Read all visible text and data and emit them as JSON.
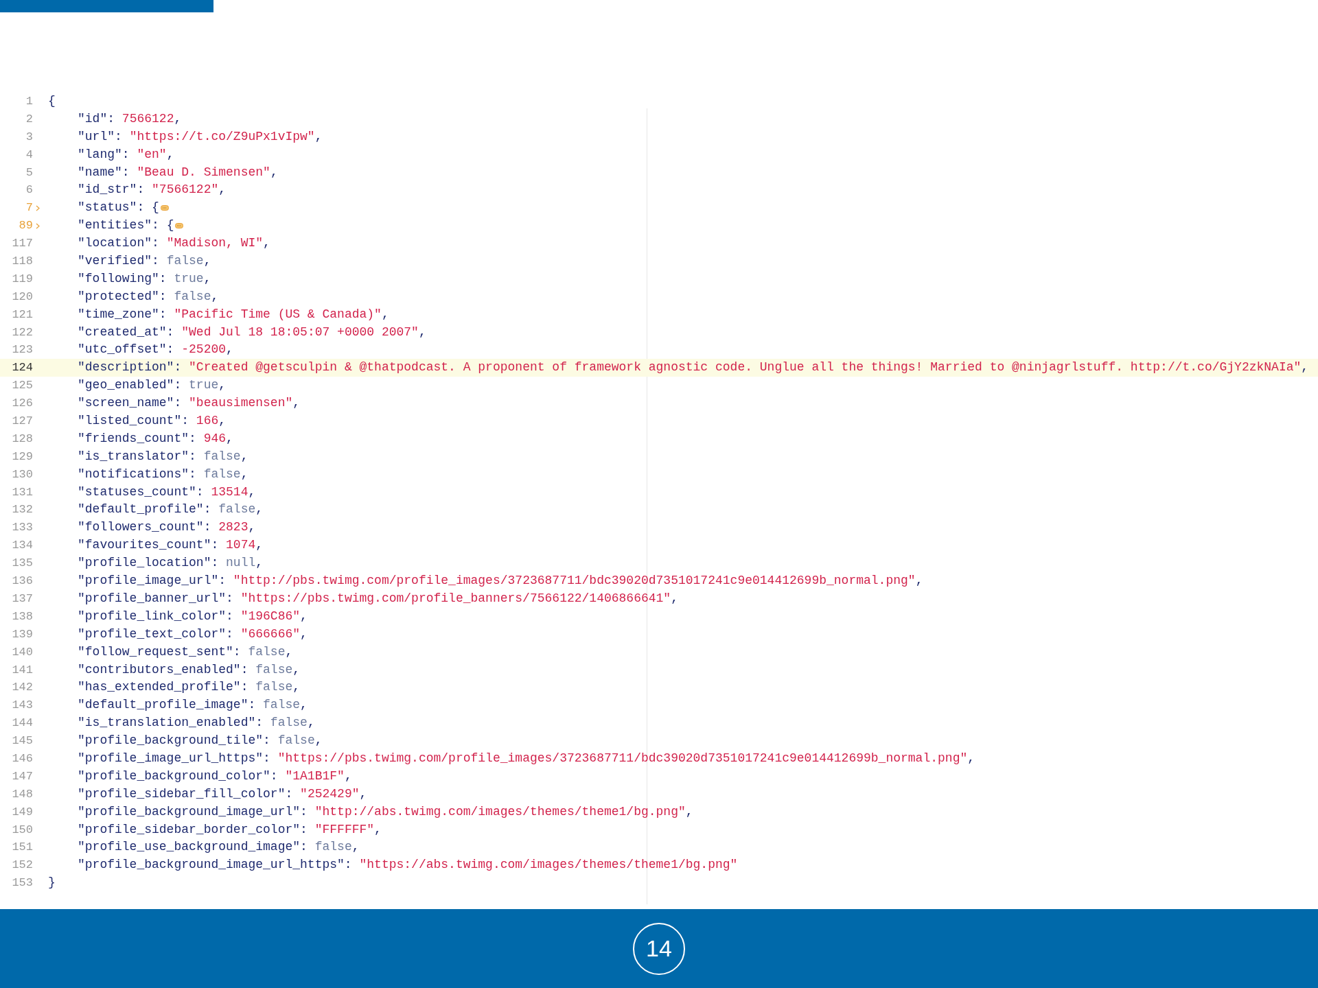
{
  "editor": {
    "lines": [
      {
        "number": "1",
        "kind": "brace",
        "value": "{",
        "folded": false,
        "current": false
      },
      {
        "number": "2",
        "key": "\"id\":",
        "value": "7566122",
        "kind": "number",
        "trail": ",",
        "folded": false,
        "current": false
      },
      {
        "number": "3",
        "key": "\"url\":",
        "value": "\"https://t.co/Z9uPx1vIpw\"",
        "kind": "string",
        "trail": ",",
        "folded": false,
        "current": false
      },
      {
        "number": "4",
        "key": "\"lang\":",
        "value": "\"en\"",
        "kind": "string",
        "trail": ",",
        "folded": false,
        "current": false
      },
      {
        "number": "5",
        "key": "\"name\":",
        "value": "\"Beau D. Simensen\"",
        "kind": "string",
        "trail": ",",
        "folded": false,
        "current": false
      },
      {
        "number": "6",
        "key": "\"id_str\":",
        "value": "\"7566122\"",
        "kind": "string",
        "trail": ",",
        "folded": false,
        "current": false
      },
      {
        "number": "7",
        "key": "\"status\":",
        "value": "{",
        "kind": "brace",
        "folded": true,
        "current": false
      },
      {
        "number": "89",
        "key": "\"entities\":",
        "value": "{",
        "kind": "brace",
        "folded": true,
        "current": false
      },
      {
        "number": "117",
        "key": "\"location\":",
        "value": "\"Madison, WI\"",
        "kind": "string",
        "trail": ",",
        "folded": false,
        "current": false
      },
      {
        "number": "118",
        "key": "\"verified\":",
        "value": "false",
        "kind": "literal",
        "trail": ",",
        "folded": false,
        "current": false
      },
      {
        "number": "119",
        "key": "\"following\":",
        "value": "true",
        "kind": "literal",
        "trail": ",",
        "folded": false,
        "current": false
      },
      {
        "number": "120",
        "key": "\"protected\":",
        "value": "false",
        "kind": "literal",
        "trail": ",",
        "folded": false,
        "current": false
      },
      {
        "number": "121",
        "key": "\"time_zone\":",
        "value": "\"Pacific Time (US & Canada)\"",
        "kind": "string",
        "trail": ",",
        "folded": false,
        "current": false
      },
      {
        "number": "122",
        "key": "\"created_at\":",
        "value": "\"Wed Jul 18 18:05:07 +0000 2007\"",
        "kind": "string",
        "trail": ",",
        "folded": false,
        "current": false
      },
      {
        "number": "123",
        "key": "\"utc_offset\":",
        "value": "-25200",
        "kind": "number",
        "trail": ",",
        "folded": false,
        "current": false
      },
      {
        "number": "124",
        "key": "\"description\":",
        "value": "\"Created @getsculpin & @thatpodcast. A proponent of framework agnostic code. Unglue all the things! Married to @ninjagrlstuff. http://t.co/GjY2zkNAIa\"",
        "kind": "string",
        "trail": ",",
        "folded": false,
        "current": true
      },
      {
        "number": "125",
        "key": "\"geo_enabled\":",
        "value": "true",
        "kind": "literal",
        "trail": ",",
        "folded": false,
        "current": false
      },
      {
        "number": "126",
        "key": "\"screen_name\":",
        "value": "\"beausimensen\"",
        "kind": "string",
        "trail": ",",
        "folded": false,
        "current": false
      },
      {
        "number": "127",
        "key": "\"listed_count\":",
        "value": "166",
        "kind": "number",
        "trail": ",",
        "folded": false,
        "current": false
      },
      {
        "number": "128",
        "key": "\"friends_count\":",
        "value": "946",
        "kind": "number",
        "trail": ",",
        "folded": false,
        "current": false
      },
      {
        "number": "129",
        "key": "\"is_translator\":",
        "value": "false",
        "kind": "literal",
        "trail": ",",
        "folded": false,
        "current": false
      },
      {
        "number": "130",
        "key": "\"notifications\":",
        "value": "false",
        "kind": "literal",
        "trail": ",",
        "folded": false,
        "current": false
      },
      {
        "number": "131",
        "key": "\"statuses_count\":",
        "value": "13514",
        "kind": "number",
        "trail": ",",
        "folded": false,
        "current": false
      },
      {
        "number": "132",
        "key": "\"default_profile\":",
        "value": "false",
        "kind": "literal",
        "trail": ",",
        "folded": false,
        "current": false
      },
      {
        "number": "133",
        "key": "\"followers_count\":",
        "value": "2823",
        "kind": "number",
        "trail": ",",
        "folded": false,
        "current": false
      },
      {
        "number": "134",
        "key": "\"favourites_count\":",
        "value": "1074",
        "kind": "number",
        "trail": ",",
        "folded": false,
        "current": false
      },
      {
        "number": "135",
        "key": "\"profile_location\":",
        "value": "null",
        "kind": "literal",
        "trail": ",",
        "folded": false,
        "current": false
      },
      {
        "number": "136",
        "key": "\"profile_image_url\":",
        "value": "\"http://pbs.twimg.com/profile_images/3723687711/bdc39020d7351017241c9e014412699b_normal.png\"",
        "kind": "string",
        "trail": ",",
        "folded": false,
        "current": false
      },
      {
        "number": "137",
        "key": "\"profile_banner_url\":",
        "value": "\"https://pbs.twimg.com/profile_banners/7566122/1406866641\"",
        "kind": "string",
        "trail": ",",
        "folded": false,
        "current": false
      },
      {
        "number": "138",
        "key": "\"profile_link_color\":",
        "value": "\"196C86\"",
        "kind": "string",
        "trail": ",",
        "folded": false,
        "current": false
      },
      {
        "number": "139",
        "key": "\"profile_text_color\":",
        "value": "\"666666\"",
        "kind": "string",
        "trail": ",",
        "folded": false,
        "current": false
      },
      {
        "number": "140",
        "key": "\"follow_request_sent\":",
        "value": "false",
        "kind": "literal",
        "trail": ",",
        "folded": false,
        "current": false
      },
      {
        "number": "141",
        "key": "\"contributors_enabled\":",
        "value": "false",
        "kind": "literal",
        "trail": ",",
        "folded": false,
        "current": false
      },
      {
        "number": "142",
        "key": "\"has_extended_profile\":",
        "value": "false",
        "kind": "literal",
        "trail": ",",
        "folded": false,
        "current": false
      },
      {
        "number": "143",
        "key": "\"default_profile_image\":",
        "value": "false",
        "kind": "literal",
        "trail": ",",
        "folded": false,
        "current": false
      },
      {
        "number": "144",
        "key": "\"is_translation_enabled\":",
        "value": "false",
        "kind": "literal",
        "trail": ",",
        "folded": false,
        "current": false
      },
      {
        "number": "145",
        "key": "\"profile_background_tile\":",
        "value": "false",
        "kind": "literal",
        "trail": ",",
        "folded": false,
        "current": false
      },
      {
        "number": "146",
        "key": "\"profile_image_url_https\":",
        "value": "\"https://pbs.twimg.com/profile_images/3723687711/bdc39020d7351017241c9e014412699b_normal.png\"",
        "kind": "string",
        "trail": ",",
        "folded": false,
        "current": false
      },
      {
        "number": "147",
        "key": "\"profile_background_color\":",
        "value": "\"1A1B1F\"",
        "kind": "string",
        "trail": ",",
        "folded": false,
        "current": false
      },
      {
        "number": "148",
        "key": "\"profile_sidebar_fill_color\":",
        "value": "\"252429\"",
        "kind": "string",
        "trail": ",",
        "folded": false,
        "current": false
      },
      {
        "number": "149",
        "key": "\"profile_background_image_url\":",
        "value": "\"http://abs.twimg.com/images/themes/theme1/bg.png\"",
        "kind": "string",
        "trail": ",",
        "folded": false,
        "current": false
      },
      {
        "number": "150",
        "key": "\"profile_sidebar_border_color\":",
        "value": "\"FFFFFF\"",
        "kind": "string",
        "trail": ",",
        "folded": false,
        "current": false
      },
      {
        "number": "151",
        "key": "\"profile_use_background_image\":",
        "value": "false",
        "kind": "literal",
        "trail": ",",
        "folded": false,
        "current": false
      },
      {
        "number": "152",
        "key": "\"profile_background_image_url_https\":",
        "value": "\"https://abs.twimg.com/images/themes/theme1/bg.png\"",
        "kind": "string",
        "folded": false,
        "current": false
      },
      {
        "number": "153",
        "kind": "brace",
        "value": "}",
        "folded": false,
        "current": false
      }
    ]
  },
  "footer": {
    "page_number": "14"
  }
}
